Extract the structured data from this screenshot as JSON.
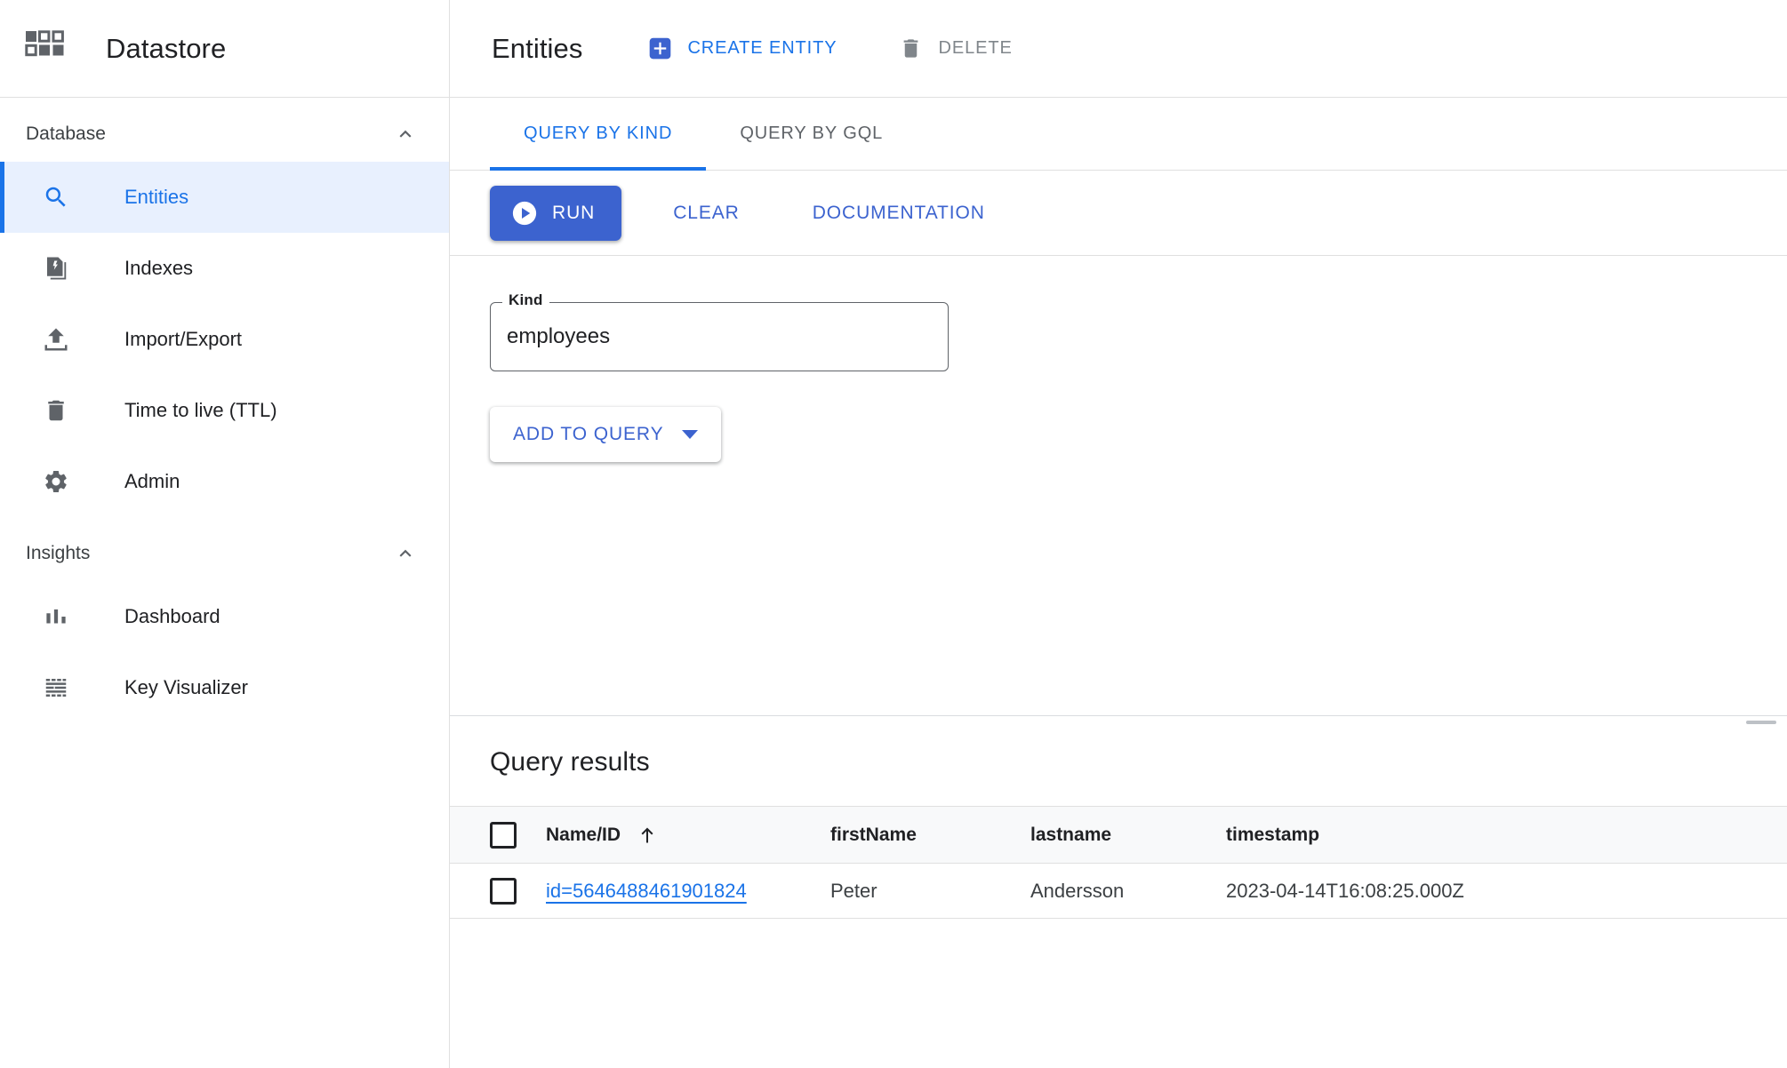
{
  "sidebar": {
    "brand": {
      "title": "Datastore",
      "logo_icon": "datastore-grid-logo"
    },
    "sections": [
      {
        "title": "Database",
        "collapse_icon": "chevron-up-icon",
        "items": [
          {
            "label": "Entities",
            "icon": "search-icon",
            "selected": true
          },
          {
            "label": "Indexes",
            "icon": "index-document-icon",
            "selected": false
          },
          {
            "label": "Import/Export",
            "icon": "upload-icon",
            "selected": false
          },
          {
            "label": "Time to live (TTL)",
            "icon": "trash-icon",
            "selected": false
          },
          {
            "label": "Admin",
            "icon": "gear-icon",
            "selected": false
          }
        ]
      },
      {
        "title": "Insights",
        "collapse_icon": "chevron-up-icon",
        "items": [
          {
            "label": "Dashboard",
            "icon": "bar-chart-icon",
            "selected": false
          },
          {
            "label": "Key Visualizer",
            "icon": "key-visualizer-grid-icon",
            "selected": false
          }
        ]
      }
    ]
  },
  "header": {
    "title": "Entities",
    "create_entity_label": "CREATE ENTITY",
    "create_entity_icon": "plus-box-icon",
    "delete_label": "DELETE",
    "delete_icon": "trash-icon",
    "delete_disabled": true
  },
  "tabs": [
    {
      "label": "QUERY BY KIND",
      "active": true
    },
    {
      "label": "QUERY BY GQL",
      "active": false
    }
  ],
  "actions": {
    "run_label": "RUN",
    "run_icon": "play-circle-icon",
    "clear_label": "CLEAR",
    "documentation_label": "DOCUMENTATION"
  },
  "query_builder": {
    "kind_label": "Kind",
    "kind_value": "employees",
    "kind_placeholder": "Kind",
    "add_to_query_label": "ADD TO QUERY",
    "add_to_query_icon": "caret-down-icon"
  },
  "results": {
    "title": "Query results",
    "columns": [
      {
        "key": "check",
        "label": ""
      },
      {
        "key": "name_id",
        "label": "Name/ID",
        "sorted": "asc",
        "sort_icon": "arrow-up-icon"
      },
      {
        "key": "firstName",
        "label": "firstName"
      },
      {
        "key": "lastname",
        "label": "lastname"
      },
      {
        "key": "timestamp",
        "label": "timestamp"
      }
    ],
    "rows": [
      {
        "selected": false,
        "name_id": "id=5646488461901824",
        "firstName": "Peter",
        "lastname": "Andersson",
        "timestamp": "2023-04-14T16:08:25.000Z"
      }
    ]
  },
  "colors": {
    "accent_blue": "#1a73e8",
    "button_blue": "#3c63cf",
    "selected_bg": "#e8f0fe",
    "icon_gray": "#5f6368",
    "disabled_gray": "#80868b"
  }
}
